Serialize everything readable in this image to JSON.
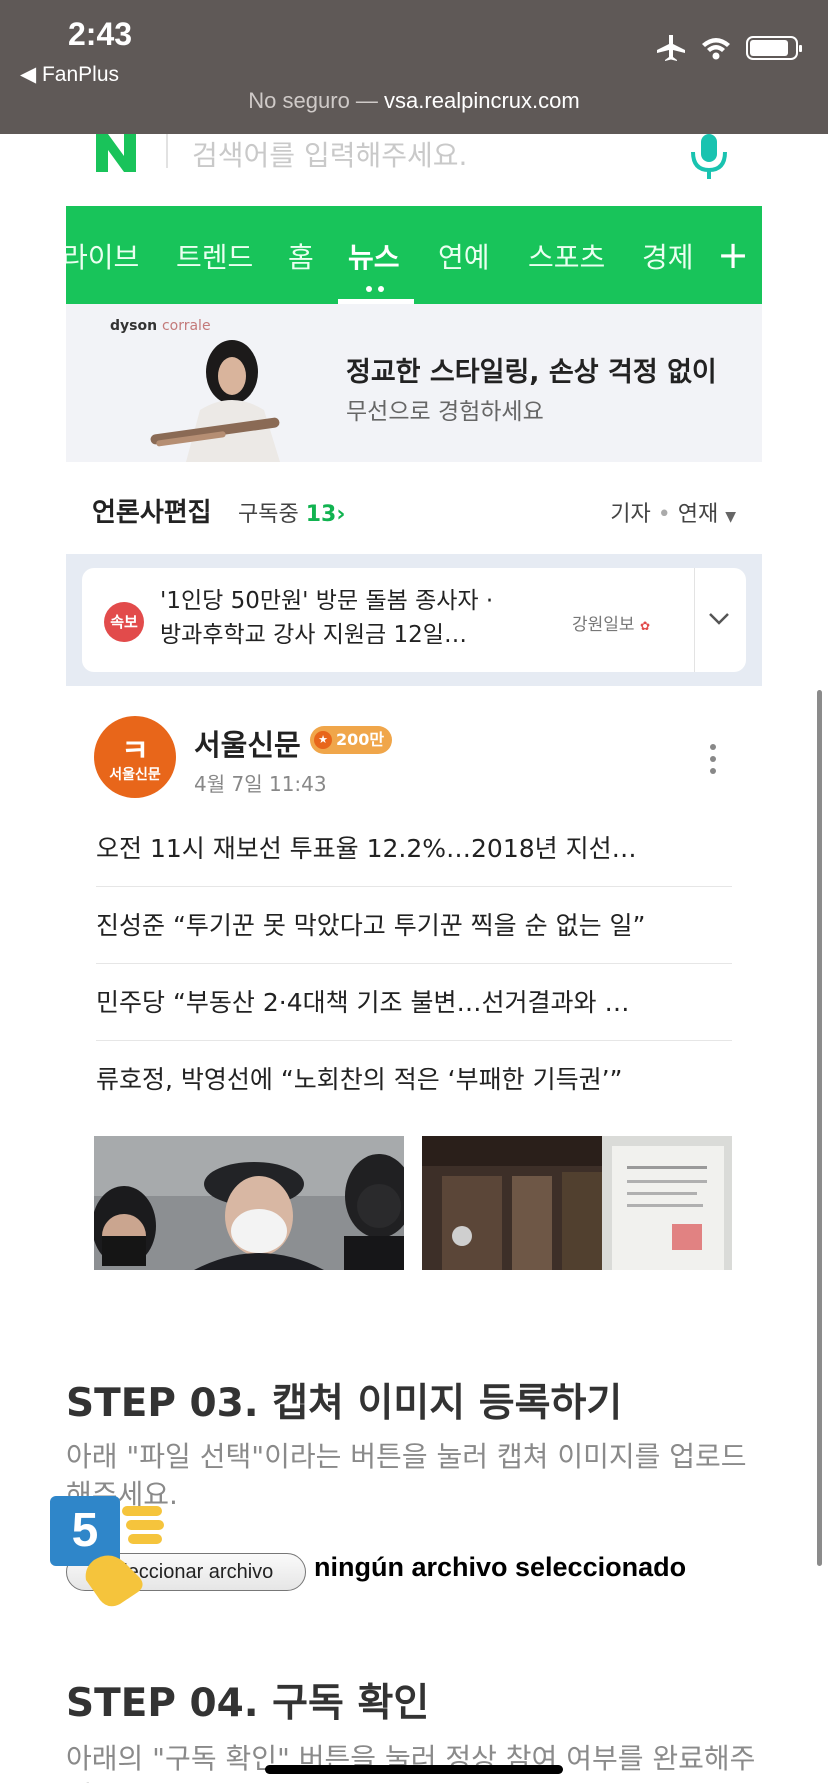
{
  "status_bar": {
    "time": "2:43",
    "back_app": "◀ FanPlus",
    "icons": [
      "airplane-icon",
      "wifi-icon",
      "battery-icon"
    ]
  },
  "url_bar": {
    "insecure_label": "No seguro —",
    "host": "vsa.realpincrux.com"
  },
  "search": {
    "logo_letter": "N",
    "placeholder": "검색어를 입력해주세요."
  },
  "nav_tabs": {
    "items": [
      "라이브",
      "트렌드",
      "홈",
      "뉴스",
      "연예",
      "스포츠",
      "경제"
    ],
    "active": "뉴스",
    "plus": "+"
  },
  "ad": {
    "brand": "dyson",
    "brand_product": "corrale",
    "title": "정교한 스타일링, 손상 걱정 없이",
    "subtitle": "무선으로 경험하세요"
  },
  "press": {
    "title": "언론사편집",
    "subscribed_label": "구독중",
    "subscribed_count": "13",
    "right_a": "기자",
    "right_sep": "•",
    "right_b": "연재"
  },
  "breaking": {
    "badge": "속보",
    "text": "'1인당 50만원' 방문 돌봄 종사자 · 방과후학교 강사 지원금 12일…",
    "source": "강원일보"
  },
  "news_card": {
    "publisher_mark": "ㅋ",
    "publisher_logo_text": "서울신문",
    "publisher_name": "서울신문",
    "badge": "200만",
    "date": "4월 7일 11:43",
    "headlines": [
      "오전 11시 재보선 투표율 12.2%…2018년 지선…",
      "진성준 “투기꾼 못 막았다고 투기꾼 찍을 순 없는 일”",
      "민주당 “부동산 2·4대책 기조 불변…선거결과와 …",
      "류호정, 박영선에 “노회찬의 적은 ‘부패한 기득권’”"
    ]
  },
  "step3": {
    "title": "STEP 03. 캡쳐 이미지 등록하기",
    "desc": "아래 \"파일 선택\"이라는 버튼을 눌러 캡쳐 이미지를 업로드해주세요.",
    "file_button": "Seleccionar archivo",
    "file_status": "ningún archivo seleccionado",
    "badge": "5"
  },
  "step4": {
    "title": "STEP 04. 구독 확인",
    "desc": "아래의 \"구독 확인\" 버튼을 눌러 정상 참여 여부를 완료해주세요."
  }
}
